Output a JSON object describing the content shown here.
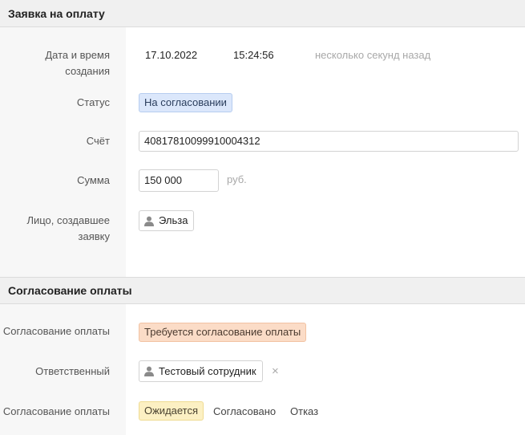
{
  "payment_request": {
    "section_title": "Заявка на оплату",
    "created_label": "Дата и время\nсоздания",
    "created_date": "17.10.2022",
    "created_time": "15:24:56",
    "created_relative": "несколько секунд назад",
    "status_label": "Статус",
    "status_value": "На согласовании",
    "account_label": "Счёт",
    "account_value": "40817810099910004312",
    "amount_label": "Сумма",
    "amount_value": "150 000",
    "amount_unit": "руб.",
    "creator_label": "Лицо, создавшее\nзаявку",
    "creator_name": "Эльза"
  },
  "approval": {
    "section_title": "Согласование оплаты",
    "approval_label": "Согласование оплаты",
    "approval_status": "Требуется согласование оплаты",
    "responsible_label": "Ответственный",
    "responsible_name": "Тестовый сотрудник",
    "remove_icon": "×",
    "decision_label": "Согласование оплаты",
    "decision_options": [
      "Ожидается",
      "Согласовано",
      "Отказ"
    ],
    "decision_selected": "Ожидается"
  },
  "colors": {
    "status_badge": "#dbe7fb",
    "approval_badge": "#fbdcc7",
    "selected_option": "#fcf0c3"
  }
}
